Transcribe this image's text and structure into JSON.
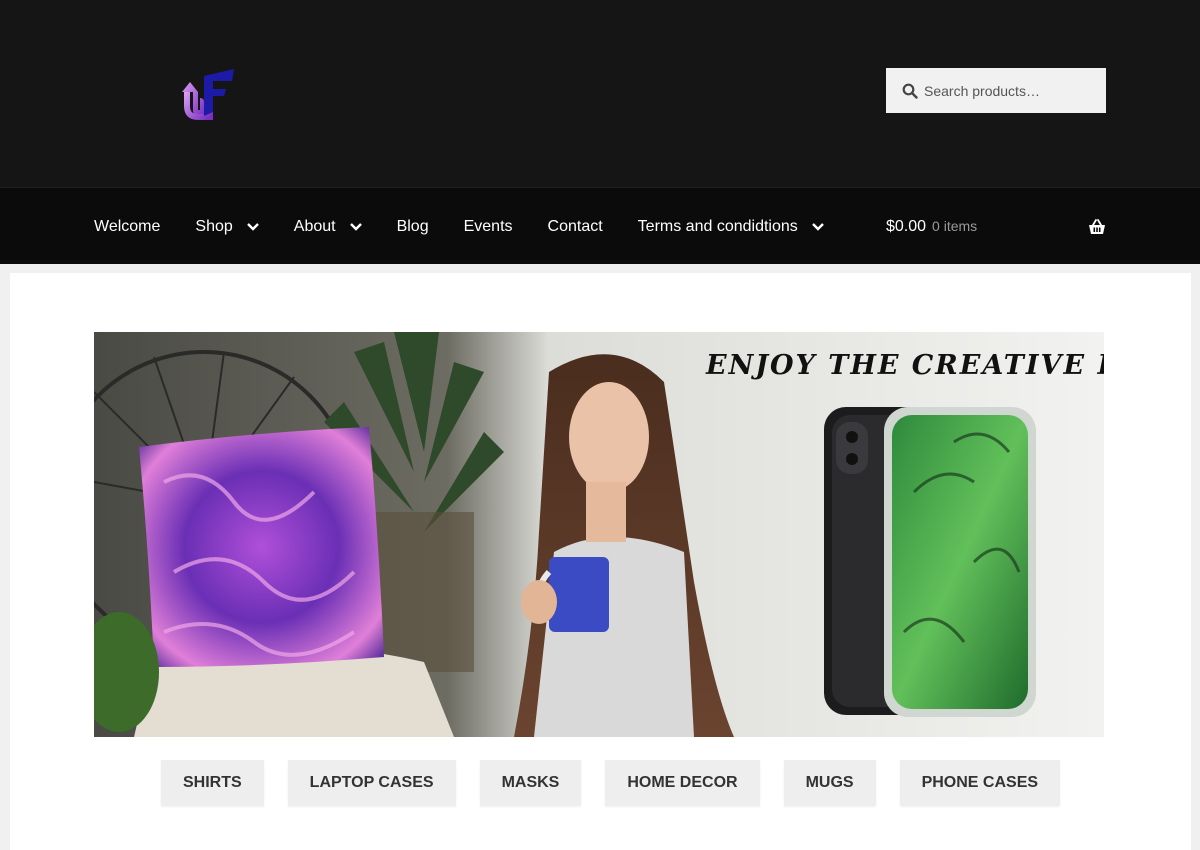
{
  "header": {
    "logo_text": "UF",
    "search": {
      "placeholder": "Search products…"
    }
  },
  "nav": {
    "items": [
      {
        "label": "Welcome",
        "has_dropdown": false,
        "active": true
      },
      {
        "label": "Shop",
        "has_dropdown": true
      },
      {
        "label": "About",
        "has_dropdown": true
      },
      {
        "label": "Blog",
        "has_dropdown": false
      },
      {
        "label": "Events",
        "has_dropdown": false
      },
      {
        "label": "Contact",
        "has_dropdown": false
      },
      {
        "label": "Terms and condidtions",
        "has_dropdown": true
      }
    ],
    "cart": {
      "amount": "$0.00",
      "count": "0 items",
      "icon": "basket-icon"
    }
  },
  "banner": {
    "tagline": "ENJOY THE CREATIVE LIFE"
  },
  "categories": [
    {
      "label": "SHIRTS"
    },
    {
      "label": "LAPTOP CASES"
    },
    {
      "label": "MASKS"
    },
    {
      "label": "HOME DECOR"
    },
    {
      "label": "MUGS"
    },
    {
      "label": "PHONE CASES"
    }
  ],
  "colors": {
    "header_bg": "#151515",
    "nav_bg": "#0b0b0b",
    "logo_purple": "#8e3fc9",
    "logo_blue": "#1e1aa8",
    "button_bg": "#eeeeee"
  }
}
